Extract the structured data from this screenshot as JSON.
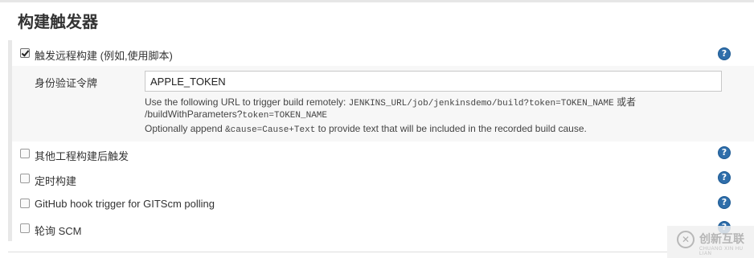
{
  "section": {
    "title": "构建触发器"
  },
  "triggers": [
    {
      "label": "触发远程构建 (例如,使用脚本)",
      "checked": true,
      "help": "?"
    },
    {
      "label": "其他工程构建后触发",
      "checked": false,
      "help": "?"
    },
    {
      "label": "定时构建",
      "checked": false,
      "help": "?"
    },
    {
      "label": "GitHub hook trigger for GITScm polling",
      "checked": false,
      "help": "?"
    },
    {
      "label": "轮询 SCM",
      "checked": false,
      "help": "?"
    }
  ],
  "remote": {
    "field_label": "身份验证令牌",
    "token_value": "APPLE_TOKEN",
    "desc_line1_prefix": "Use the following URL to trigger build remotely: ",
    "desc_line1_code": "JENKINS_URL/job/jenkinsdemo/build?token=TOKEN_NAME",
    "desc_line1_suffix": " 或者",
    "desc_line2_prefix": "/buildWithParameters?",
    "desc_line2_code": "token=TOKEN_NAME",
    "desc_line3_prefix": "Optionally append ",
    "desc_line3_code": "&cause=Cause+Text",
    "desc_line3_suffix": " to provide text that will be included in the recorded build cause."
  },
  "watermark": {
    "logo": "✕",
    "text": "创新互联",
    "sub": "CHUANG XIN HU LIAN"
  }
}
